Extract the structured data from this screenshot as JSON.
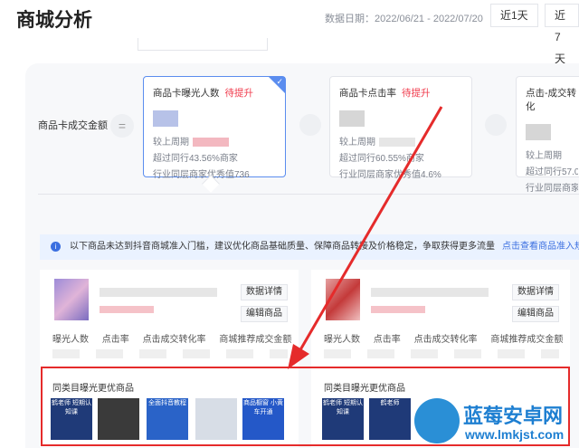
{
  "header": {
    "title": "商城分析",
    "date_range": "数据日期：2022/06/21 - 2022/07/20",
    "range_buttons": [
      "近1天",
      "近7天"
    ]
  },
  "formula": {
    "label": "商品卡成交金额",
    "equals": "="
  },
  "metric_cards": [
    {
      "title": "商品卡曝光人数",
      "tag": "待提升",
      "compare_label": "较上周期",
      "peer_text": "超过同行43.56%商家",
      "benchmark": "行业同层商家优秀值736",
      "selected": true
    },
    {
      "title": "商品卡点击率",
      "tag": "待提升",
      "compare_label": "较上周期",
      "peer_text": "超过同行60.55%商家",
      "benchmark": "行业同层商家优秀值4.6%",
      "selected": false
    },
    {
      "title": "点击-成交转化",
      "tag": "",
      "compare_label": "较上周期",
      "peer_text": "超过同行57.0",
      "benchmark": "行业同层商家",
      "selected": false
    }
  ],
  "notice": {
    "text": "以下商品未达到抖音商城准入门槛，建议优化商品基础质量、保障商品转接及价格稳定，争取获得更多流量",
    "link": "点击查看商品准入规"
  },
  "product_cards": [
    {
      "detail_button": "数据详情",
      "edit_button": "编辑商品",
      "stats": [
        "曝光人数",
        "点击率",
        "点击成交转化率",
        "商城推荐成交金额"
      ],
      "same_category_title": "同类目曝光更优商品"
    },
    {
      "detail_button": "数据详情",
      "edit_button": "编辑商品",
      "stats": [
        "曝光人数",
        "点击率",
        "点击成交转化率",
        "商城推荐成交金额"
      ],
      "same_category_title": "同类目曝光更优商品"
    }
  ],
  "thumbnails": {
    "left": [
      "鹤老师 短期认知课",
      "",
      "全面抖音教程",
      "",
      "商品橱窗 小黄车开通"
    ],
    "right": [
      "鹤老师 短期认知课",
      "鹤老师"
    ]
  },
  "watermark": {
    "brand": "蓝莓安卓网",
    "url": "www.lmkjst.com"
  },
  "colors": {
    "accent": "#5b8def",
    "tag_red": "#f0394b",
    "link_blue": "#3b6fe0",
    "highlight_red": "#e52b2b"
  }
}
